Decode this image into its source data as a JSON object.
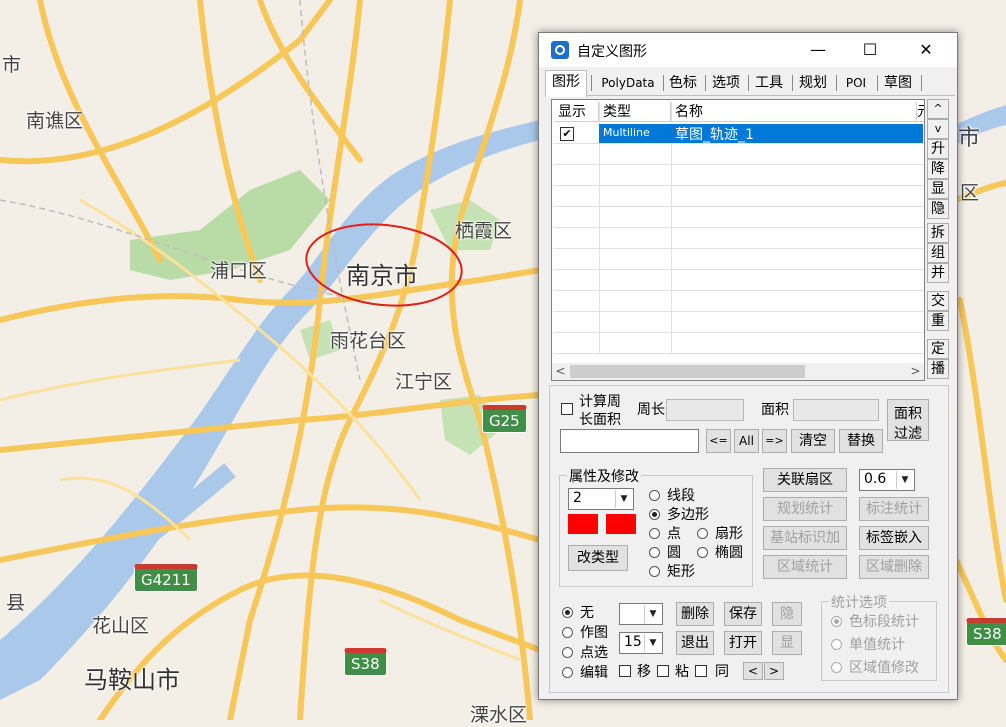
{
  "map": {
    "labels": {
      "shi_left": "市",
      "nanqiao": "南谯区",
      "pukou": "浦口区",
      "nanjing": "南京市",
      "qixia": "栖霞区",
      "yuhuatai": "雨花台区",
      "jiangning": "江宁区",
      "huashan": "花山区",
      "maanshan": "马鞍山市",
      "shi_right": "市",
      "qu_right": "区",
      "xian_left": "县",
      "bottom_partial": "溧水区"
    },
    "shields": {
      "g25": "G25",
      "g4211": "G4211",
      "s38a": "S38",
      "s38b": "S38"
    },
    "colors": {
      "road": "#f7c75a",
      "water": "#a9c8ea",
      "green": "#b9dba6",
      "ellipse": "#e0201a"
    }
  },
  "dialog": {
    "title": "自定义图形",
    "controls": {
      "minimize": "—",
      "maximize": "☐",
      "close": "✕"
    },
    "tabs": [
      "图形",
      "PolyData",
      "色标",
      "选项",
      "工具",
      "规划",
      "POI",
      "草图"
    ],
    "grid": {
      "headers": {
        "show": "显示",
        "type": "类型",
        "name": "名称",
        "extra": "元"
      },
      "rows": [
        {
          "checked": "✔",
          "type": "Multiline",
          "name": "草图_轨迹_1"
        }
      ],
      "scroll_left": "<",
      "scroll_right": ">"
    },
    "side_buttons": {
      "up": "^",
      "down": "v",
      "raise": "升",
      "lower": "降",
      "show": "显",
      "hide": "隐",
      "split": "拆",
      "group": "组",
      "merge": "并",
      "cross": "交",
      "overlap": "重",
      "locate": "定",
      "play": "播"
    },
    "calc": {
      "checkbox_label_1": "计算周",
      "checkbox_label_2": "长面积",
      "perimeter_label": "周长",
      "area_label": "面积",
      "area_filter_1": "面积",
      "area_filter_2": "过滤",
      "btn_left": "<=",
      "btn_all": "All",
      "btn_right": "=>",
      "btn_clear": "清空",
      "btn_replace": "替换"
    },
    "props": {
      "group_title": "属性及修改",
      "line_width": "2",
      "types": {
        "segment": "线段",
        "polygon": "多边形",
        "point": "点",
        "sector": "扇形",
        "circle": "圆",
        "ellipse": "椭圆",
        "rect": "矩形"
      },
      "change_type": "改类型",
      "fill_color": "#ff0000"
    },
    "right_buttons": {
      "sector_link": "关联扇区",
      "opacity": "0.6",
      "plan_stats": "规划统计",
      "label_stats": "标注统计",
      "base_station": "基站标识加",
      "embed_label": "标签嵌入",
      "area_stats": "区域统计",
      "area_delete": "区域删除"
    },
    "bottom": {
      "modes": {
        "none": "无",
        "draw": "作图",
        "pick": "点选",
        "edit": "编辑"
      },
      "size": "15",
      "delete": "删除",
      "save": "保存",
      "hide": "隐",
      "exit": "退出",
      "open": "打开",
      "show": "显",
      "move": "移",
      "paste": "粘",
      "same": "同",
      "prev": "<",
      "next": ">"
    },
    "stats": {
      "title": "统计选项",
      "opt1": "色标段统计",
      "opt2": "单值统计",
      "opt3": "区域值修改"
    }
  }
}
